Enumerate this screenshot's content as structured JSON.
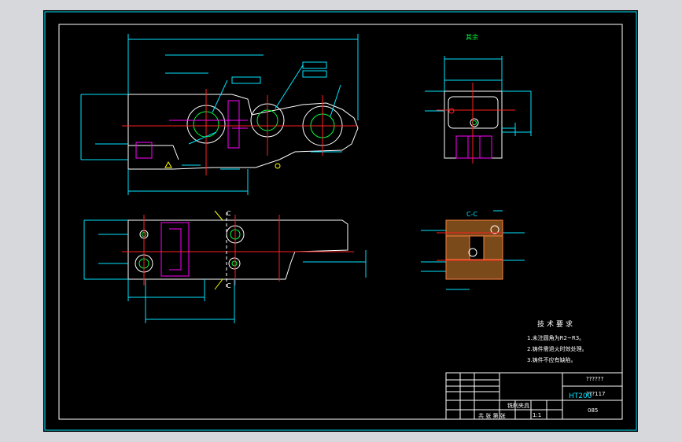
{
  "drawing": {
    "material": "HT200",
    "roughness_symbol": "其余",
    "section_label_top": "C",
    "section_label_bottom": "C",
    "section_view_label": "C-C",
    "tech_requirements": {
      "title": "技术要求",
      "lines": [
        "1.未注圆角为R2~R3。",
        "2.铸件需退火时效处理。",
        "3.铸件不应有缺陷。"
      ]
    },
    "title_block": {
      "drawing_name_1": "??????",
      "drawing_name_2": "???117",
      "scale_note": "1:1",
      "sheet_info": "共 张 第 张",
      "code": "085",
      "company": "铣削夹具"
    }
  }
}
